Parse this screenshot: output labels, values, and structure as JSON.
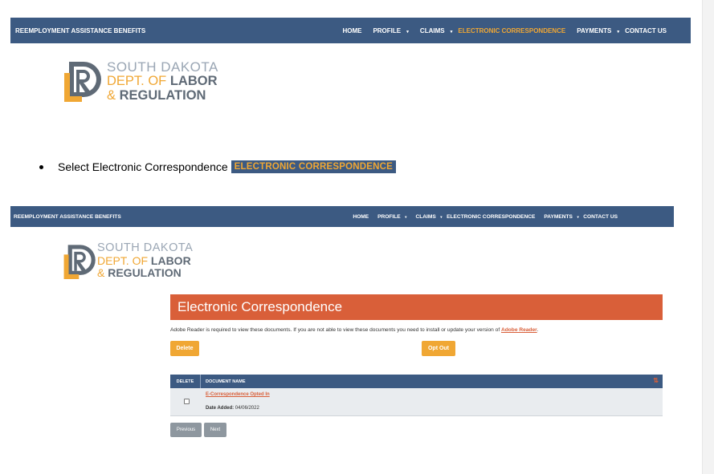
{
  "nav": {
    "brand": "REEMPLOYMENT ASSISTANCE BENEFITS",
    "items": [
      "HOME",
      "PROFILE",
      "CLAIMS",
      "ELECTRONIC CORRESPONDENCE",
      "PAYMENTS",
      "CONTACT US"
    ],
    "caret": "▾"
  },
  "logo": {
    "line1": "SOUTH DAKOTA",
    "line2a": "DEPT. OF ",
    "line2b": "LABOR",
    "amp": "& ",
    "line3": "REGULATION"
  },
  "instruction": {
    "text": "Select Electronic Correspondence",
    "highlight": "ELECTRONIC CORRESPONDENCE"
  },
  "panel": {
    "title": "Electronic Correspondence",
    "info_text": "Adobe Reader is required to view these documents. If you are not able to view these documents you need to install or update your version of ",
    "info_link": "Adobe Reader",
    "info_end": ".",
    "delete_label": "Delete",
    "optout_label": "Opt Out"
  },
  "table": {
    "headers": [
      "DELETE",
      "DOCUMENT NAME"
    ],
    "sort_icon": "⇅",
    "rows": [
      {
        "doc_name": "E-Correspondence Opted In",
        "date_label": "Date Added:",
        "date_value": " 04/06/2022"
      }
    ]
  },
  "pager": {
    "previous": "Previous",
    "next": "Next"
  },
  "colors": {
    "nav": "#3c5a82",
    "accent": "#f0a734",
    "header": "#d95f39",
    "button_gray": "#8e979f"
  }
}
